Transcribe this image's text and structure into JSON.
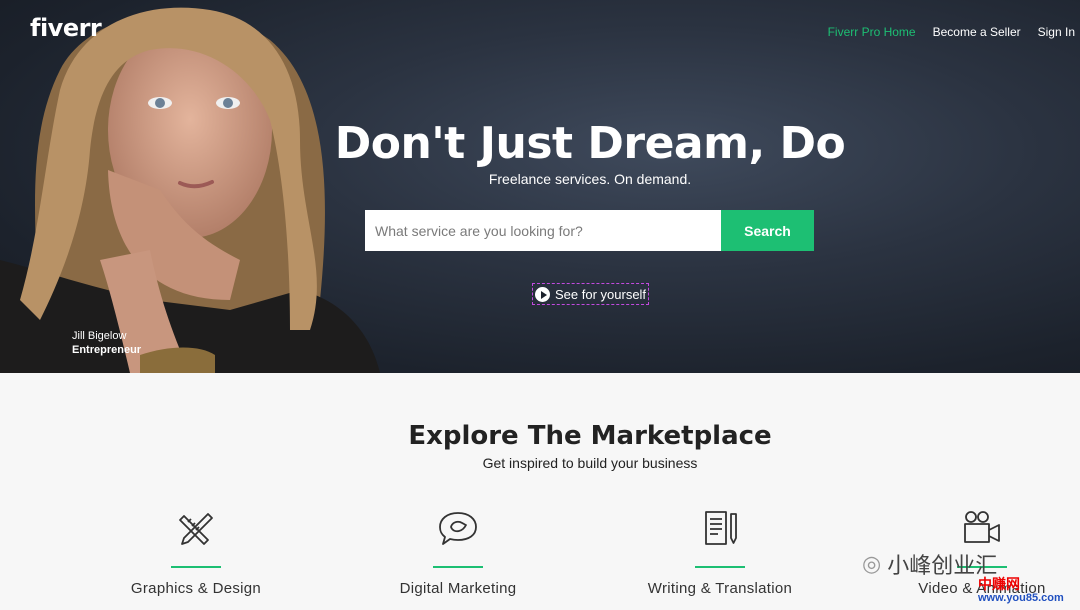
{
  "brand": {
    "logo": "fiverr",
    "accent": "#1dbf73"
  },
  "nav": {
    "pro": "Fiverr Pro Home",
    "seller": "Become a Seller",
    "signin": "Sign In"
  },
  "hero": {
    "headline": "Don't Just Dream, Do",
    "subline": "Freelance services. On demand.",
    "search_placeholder": "What service are you looking for?",
    "search_button": "Search",
    "video_link": "See for yourself",
    "person_name": "Jill Bigelow",
    "person_role": "Entrepreneur"
  },
  "explore": {
    "title": "Explore The Marketplace",
    "subtitle": "Get inspired to build your business",
    "categories": [
      {
        "label": "Graphics & Design",
        "icon": "pencil-ruler-icon"
      },
      {
        "label": "Digital Marketing",
        "icon": "speech-bubble-bird-icon"
      },
      {
        "label": "Writing & Translation",
        "icon": "document-pen-icon"
      },
      {
        "label": "Video & Animation",
        "icon": "video-camera-icon"
      }
    ]
  },
  "watermark": {
    "text": "小峰创业汇",
    "site_cn": "中赚网",
    "site_url": "www.you85.com"
  }
}
